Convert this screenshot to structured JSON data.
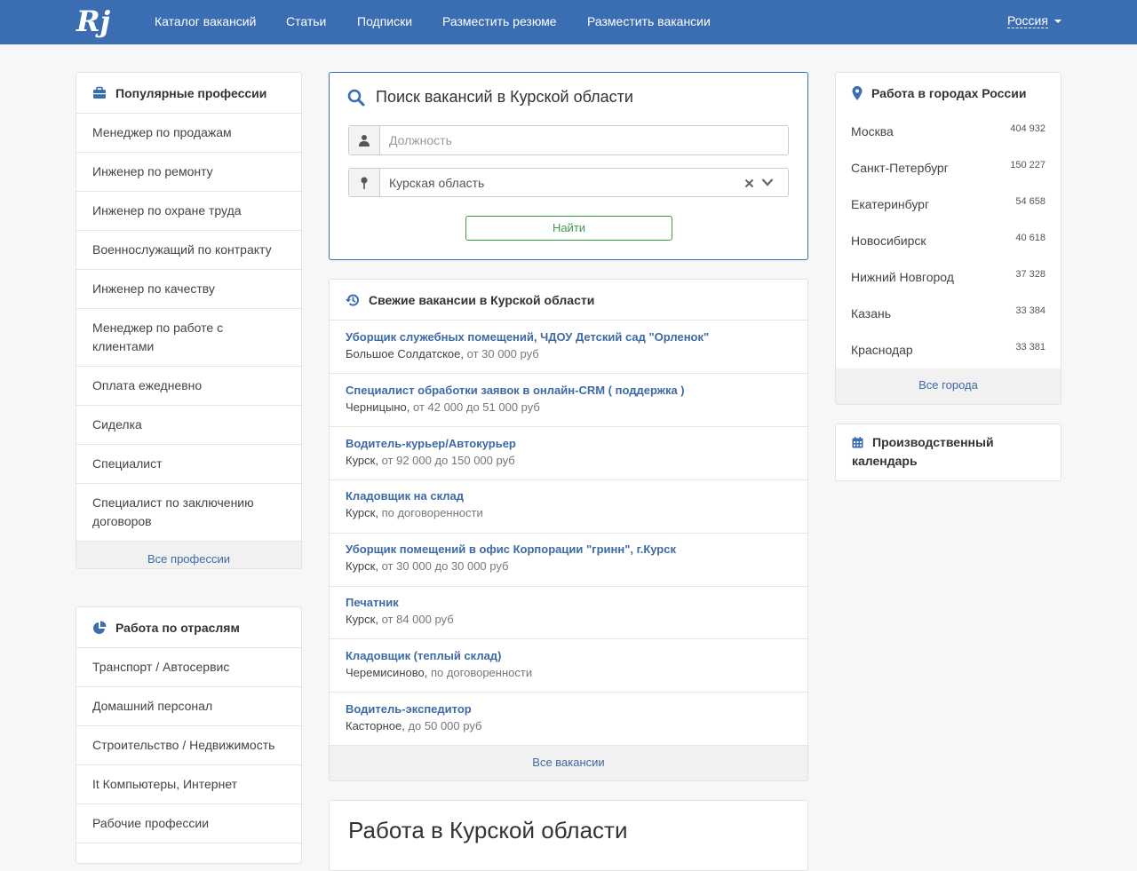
{
  "header": {
    "logo": "Rj",
    "nav": [
      "Каталог вакансий",
      "Статьи",
      "Подписки",
      "Разместить резюме",
      "Разместить вакансии"
    ],
    "region": "Россия"
  },
  "professions": {
    "title": "Популярные профессии",
    "items": [
      "Менеджер по продажам",
      "Инженер по ремонту",
      "Инженер по охране труда",
      "Военнослужащий по контракту",
      "Инженер по качеству",
      "Менеджер по работе с клиентами",
      "Оплата ежедневно",
      "Сиделка",
      "Специалист",
      "Специалист по заключению договоров"
    ],
    "all_link": "Все профессии"
  },
  "industries": {
    "title": "Работа по отраслям",
    "items": [
      "Транспорт / Автосервис",
      "Домашний персонал",
      "Строительство / Недвижимость",
      "It Компьютеры, Интернет",
      "Рабочие профессии"
    ]
  },
  "search": {
    "title": "Поиск вакансий в Курской области",
    "position_placeholder": "Должность",
    "region_value": "Курская область",
    "button": "Найти"
  },
  "fresh": {
    "title": "Свежие вакансии в Курской области",
    "items": [
      {
        "title": "Уборщик служебных помещений, ЧДОУ Детский сад \"Орленок\"",
        "city": "Большое Солдатское",
        "salary": "от 30 000 руб"
      },
      {
        "title": "Специалист обработки заявок в онлайн-CRM ( поддержка )",
        "city": "Черницыно",
        "salary": "от 42 000 до 51 000 руб"
      },
      {
        "title": "Водитель-курьер/Автокурьер",
        "city": "Курск",
        "salary": "от 92 000 до 150 000 руб"
      },
      {
        "title": "Кладовщик на склад",
        "city": "Курск",
        "salary": "по договоренности"
      },
      {
        "title": "Уборщик помещений в офис Корпорации \"гринн\", г.Курск",
        "city": "Курск",
        "salary": "от 30 000 до 30 000 руб"
      },
      {
        "title": "Печатник",
        "city": "Курск",
        "salary": "от 84 000 руб"
      },
      {
        "title": "Кладовщик (теплый склад)",
        "city": "Черемисиново",
        "salary": "по договоренности"
      },
      {
        "title": "Водитель-экспедитор",
        "city": "Касторное",
        "salary": "до 50 000 руб"
      }
    ],
    "all_link": "Все вакансии"
  },
  "region_work": {
    "title": "Работа в Курской области"
  },
  "cities": {
    "title": "Работа в городах России",
    "items": [
      {
        "name": "Москва",
        "count": "404 932"
      },
      {
        "name": "Санкт-Петербург",
        "count": "150 227"
      },
      {
        "name": "Екатеринбург",
        "count": "54 658"
      },
      {
        "name": "Новосибирск",
        "count": "40 618"
      },
      {
        "name": "Нижний Новгород",
        "count": "37 328"
      },
      {
        "name": "Казань",
        "count": "33 384"
      },
      {
        "name": "Краснодар",
        "count": "33 381"
      }
    ],
    "all_link": "Все города"
  },
  "calendar": {
    "title": "Производственный календарь"
  },
  "colors": {
    "header": "#3b6db3",
    "link": "#3d6aa6",
    "button": "#3a9b48"
  }
}
